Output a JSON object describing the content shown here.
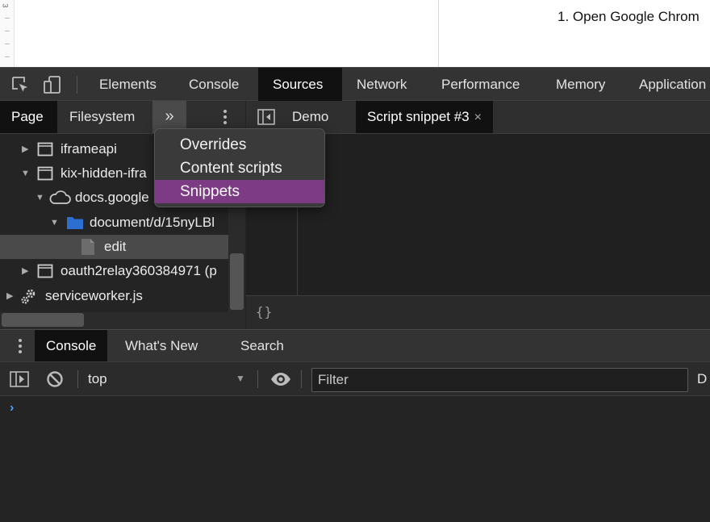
{
  "page": {
    "gutter_number": "3",
    "list_item": "1.  Open Google Chrom"
  },
  "devtools": {
    "main_tabs": [
      "Elements",
      "Console",
      "Sources",
      "Network",
      "Performance",
      "Memory",
      "Application"
    ],
    "active_main_tab": "Sources",
    "navigator": {
      "tabs": [
        "Page",
        "Filesystem"
      ],
      "more_symbol": "»",
      "tree": [
        {
          "label": "iframeapi",
          "icon": "frame-icon"
        },
        {
          "label": "kix-hidden-ifra",
          "icon": "frame-icon"
        },
        {
          "label": "docs.google",
          "icon": "cloud-icon"
        },
        {
          "label": "document/d/15nyLBl",
          "icon": "folder-icon"
        },
        {
          "label": "edit",
          "icon": "file-icon"
        },
        {
          "label": "oauth2relay360384971 (p",
          "icon": "frame-icon"
        },
        {
          "label": "serviceworker.js",
          "icon": "gear-icon"
        }
      ]
    },
    "more_menu": {
      "items": [
        "Overrides",
        "Content scripts",
        "Snippets"
      ],
      "highlighted": "Snippets"
    },
    "editor": {
      "tabs": [
        {
          "label": "Demo"
        },
        {
          "label": "Script snippet #3",
          "close": "×"
        }
      ],
      "pretty_print": "{}"
    },
    "drawer": {
      "tabs": [
        "Console",
        "What's New",
        "Search"
      ],
      "context": "top",
      "filter_placeholder": "Filter",
      "levels_partial": "D",
      "prompt_symbol": "›"
    }
  },
  "colors": {
    "highlight": "#7d3b85",
    "prompt": "#4f9dfa",
    "folder": "#2c6fd1"
  }
}
